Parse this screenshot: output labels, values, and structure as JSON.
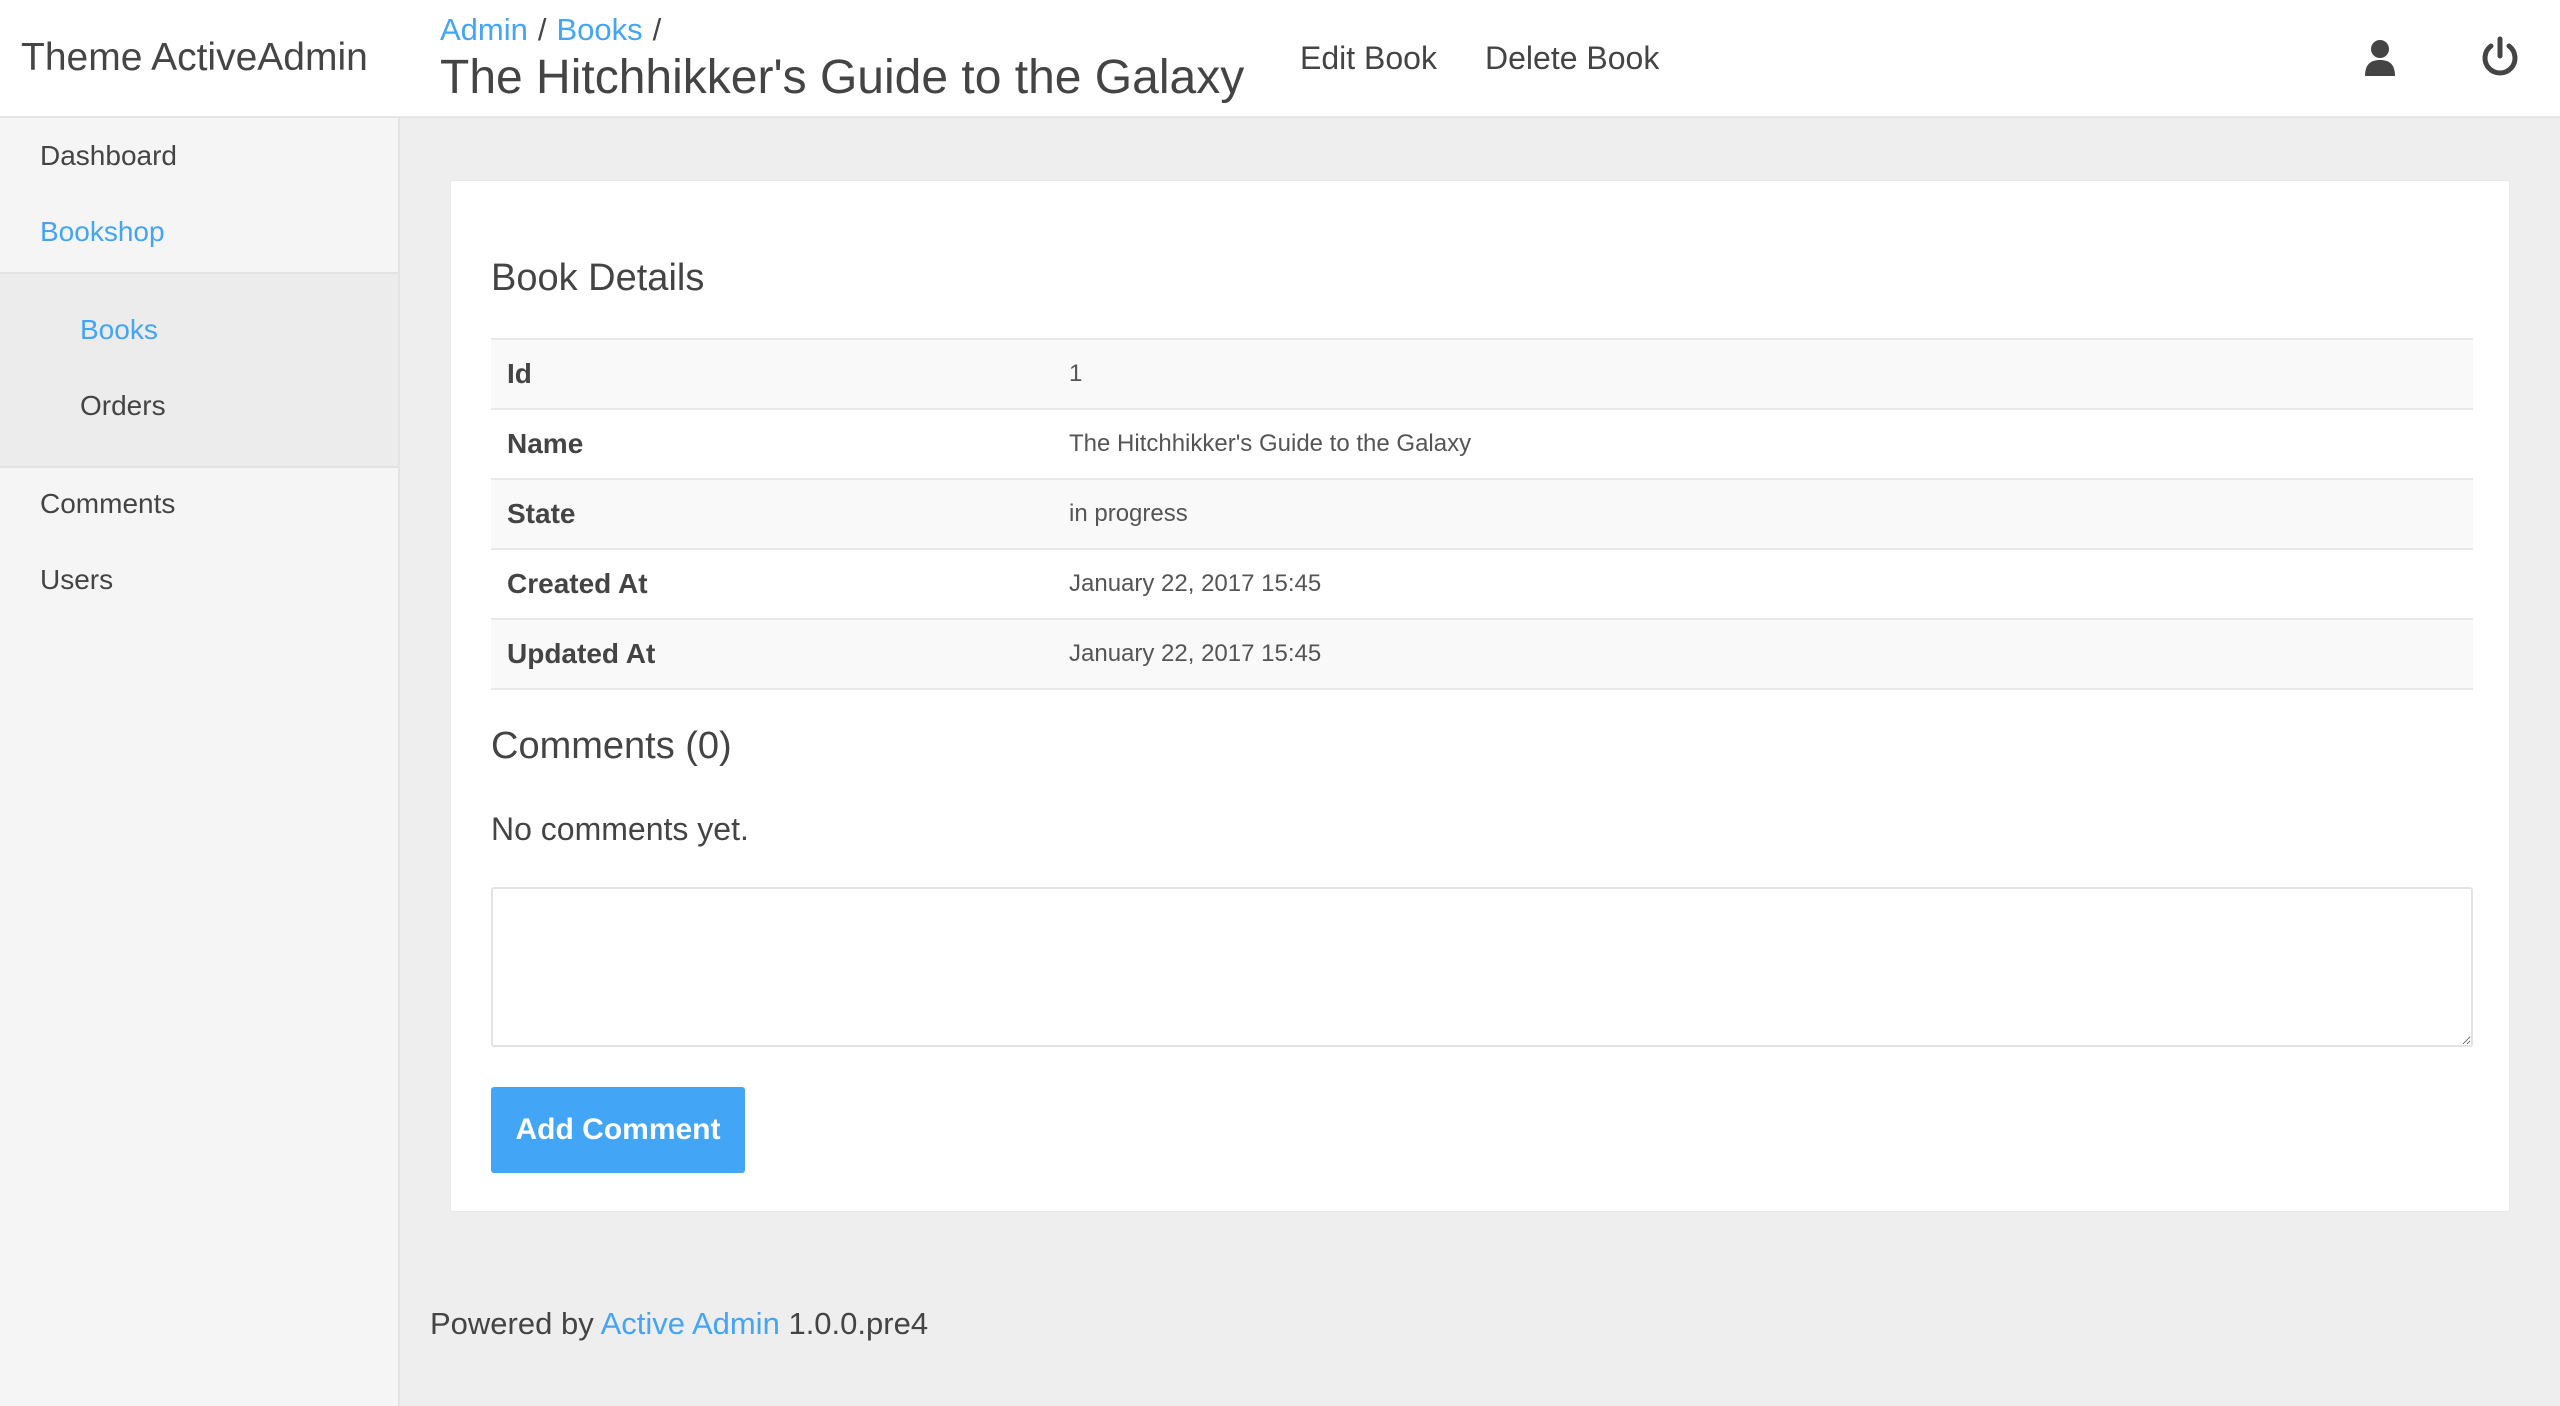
{
  "header": {
    "brand": "Theme ActiveAdmin",
    "breadcrumb": [
      {
        "label": "Admin"
      },
      {
        "label": "Books"
      }
    ],
    "separator": "/",
    "title": "The Hitchhikker's Guide to the Galaxy",
    "actions": {
      "edit": "Edit Book",
      "delete": "Delete Book"
    },
    "icons": {
      "user": "user-icon",
      "logout": "power-icon"
    }
  },
  "sidebar": {
    "items": [
      {
        "label": "Dashboard"
      },
      {
        "label": "Bookshop"
      },
      {
        "label": "Comments"
      },
      {
        "label": "Users"
      }
    ],
    "subitems": [
      {
        "label": "Books"
      },
      {
        "label": "Orders"
      }
    ]
  },
  "details": {
    "title": "Book Details",
    "rows": [
      {
        "label": "Id",
        "value": "1"
      },
      {
        "label": "Name",
        "value": "The Hitchhikker's Guide to the Galaxy"
      },
      {
        "label": "State",
        "value": "in progress"
      },
      {
        "label": "Created At",
        "value": "January 22, 2017 15:45"
      },
      {
        "label": "Updated At",
        "value": "January 22, 2017 15:45"
      }
    ]
  },
  "comments": {
    "title": "Comments (0)",
    "empty_text": "No comments yet.",
    "textarea_value": "",
    "submit_label": "Add Comment"
  },
  "footer": {
    "prefix": "Powered by",
    "link": "Active Admin",
    "version": "1.0.0.pre4"
  },
  "colors": {
    "accent": "#42a5f5",
    "text": "#444444",
    "background": "#eeeeee",
    "sidebar": "#f5f5f5"
  }
}
